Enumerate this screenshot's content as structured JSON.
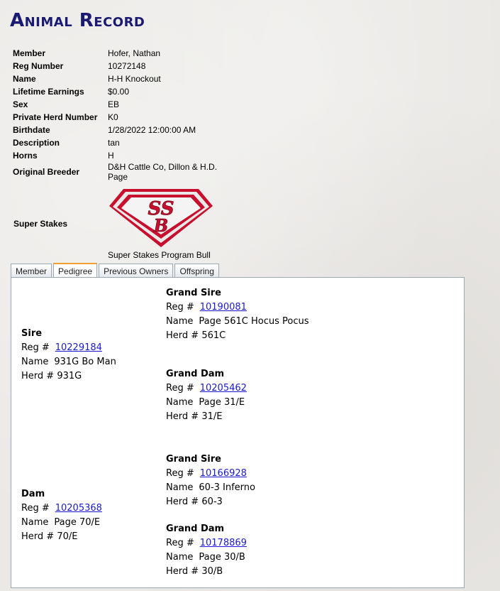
{
  "page": {
    "title": "Animal Record"
  },
  "record": [
    {
      "label": "Member",
      "value": "Hofer, Nathan"
    },
    {
      "label": "Reg Number",
      "value": "10272148"
    },
    {
      "label": "Name",
      "value": "H-H Knockout"
    },
    {
      "label": "Lifetime Earnings",
      "value": "$0.00"
    },
    {
      "label": "Sex",
      "value": "EB"
    },
    {
      "label": "Private Herd Number",
      "value": "K0"
    },
    {
      "label": "Birthdate",
      "value": "1/28/2022 12:00:00 AM"
    },
    {
      "label": "Description",
      "value": "tan"
    },
    {
      "label": "Horns",
      "value": "H"
    },
    {
      "label": "Original Breeder",
      "value": "D&H Cattle Co, Dillon & H.D. Page"
    }
  ],
  "super_stakes": {
    "label": "Super Stakes",
    "logo_text_top": "SS",
    "logo_text_bottom": "B",
    "caption": "Super Stakes Program Bull",
    "logo_colors": {
      "red": "#c8102e",
      "silver": "#d9d9d9"
    }
  },
  "tabs": [
    {
      "label": "Member",
      "active": false
    },
    {
      "label": "Pedigree",
      "active": true
    },
    {
      "label": "Previous Owners",
      "active": false
    },
    {
      "label": "Offspring",
      "active": false
    }
  ],
  "pedigree": {
    "reg_label": "Reg #",
    "name_label": "Name",
    "herd_label": "Herd #",
    "sire": {
      "title": "Sire",
      "reg": "10229184",
      "name": "931G Bo Man",
      "herd": "931G"
    },
    "sire_grand_sire": {
      "title": "Grand Sire",
      "reg": "10190081",
      "name": "Page 561C Hocus Pocus",
      "herd": "561C"
    },
    "sire_grand_dam": {
      "title": "Grand Dam",
      "reg": "10205462",
      "name": "Page 31/E",
      "herd": "31/E"
    },
    "dam": {
      "title": "Dam",
      "reg": "10205368",
      "name": "Page 70/E",
      "herd": "70/E"
    },
    "dam_grand_sire": {
      "title": "Grand Sire",
      "reg": "10166928",
      "name": "60-3 Inferno",
      "herd": "60-3"
    },
    "dam_grand_dam": {
      "title": "Grand Dam",
      "reg": "10178869",
      "name": "Page 30/B",
      "herd": "30/B"
    }
  },
  "colors": {
    "title": "#1a1a73",
    "link": "#1a1acc",
    "active_tab_accent": "#f0a030"
  }
}
